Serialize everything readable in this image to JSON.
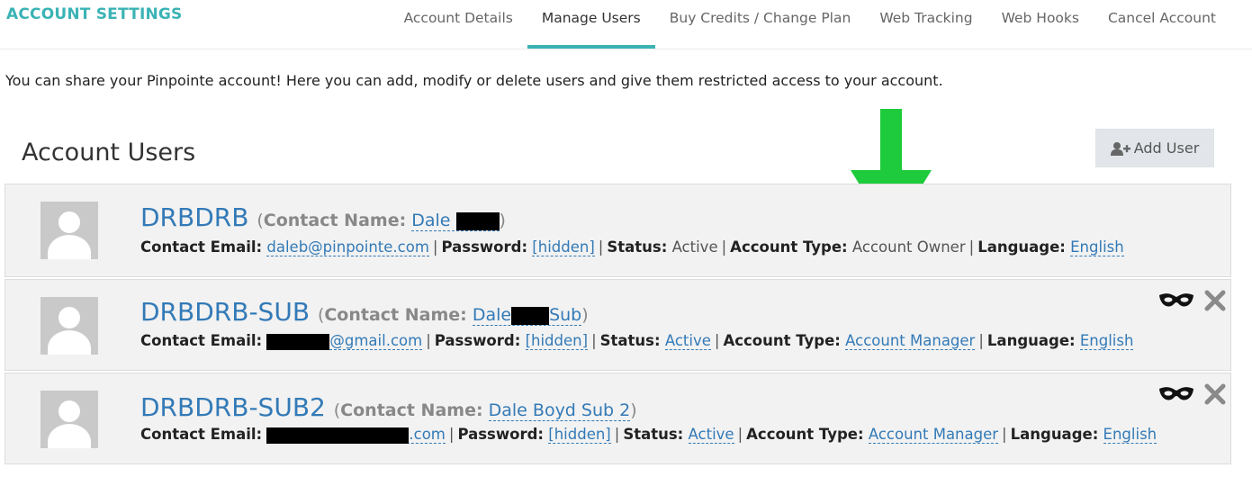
{
  "brand": "ACCOUNT SETTINGS",
  "tabs": [
    {
      "label": "Account Details"
    },
    {
      "label": "Manage Users"
    },
    {
      "label": "Buy Credits / Change Plan"
    },
    {
      "label": "Web Tracking"
    },
    {
      "label": "Web Hooks"
    },
    {
      "label": "Cancel Account"
    }
  ],
  "active_tab": "Manage Users",
  "intro": "You can share your Pinpointe account! Here you can add, modify or delete users and give them restricted access to your account.",
  "section_title": "Account Users",
  "add_user_label": "Add User",
  "labels": {
    "contact_name": "Contact Name:",
    "contact_email": "Contact Email:",
    "password": "Password:",
    "status": "Status:",
    "account_type": "Account Type:",
    "language": "Language:"
  },
  "users": [
    {
      "username": "DRBDRB",
      "contact_name": "Dale",
      "contact_name_suffix": "",
      "email_prefix": "daleb@pinpointe.com",
      "email_suffix": "",
      "password": "[hidden]",
      "status": "Active",
      "account_type": "Account Owner",
      "language": "English"
    },
    {
      "username": "DRBDRB-SUB",
      "contact_name": "Dale",
      "contact_name_suffix": "Sub",
      "email_prefix": "",
      "email_suffix": "@gmail.com",
      "password": "[hidden]",
      "status": "Active",
      "account_type": "Account Manager",
      "language": "English"
    },
    {
      "username": "DRBDRB-SUB2",
      "contact_name": "Dale Boyd Sub 2",
      "contact_name_suffix": "",
      "email_prefix": "",
      "email_suffix": ".com",
      "password": "[hidden]",
      "status": "Active",
      "account_type": "Account Manager",
      "language": "English"
    }
  ],
  "colors": {
    "brand": "#3bb3b5",
    "link": "#337ab7",
    "arrow": "#1ecb3c"
  },
  "icons": [
    "user-avatar-icon",
    "add-user-icon",
    "login-as-mask-icon",
    "delete-x-icon",
    "green-arrow-down"
  ]
}
